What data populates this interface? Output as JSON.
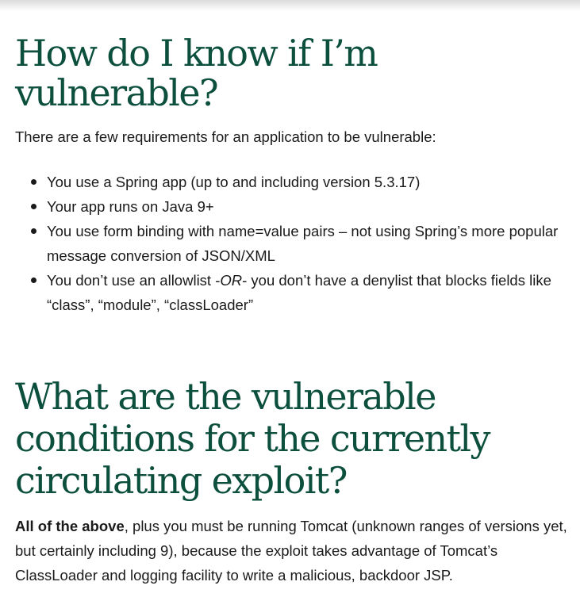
{
  "section1": {
    "heading": "How do I know if I’m vulnerable?",
    "intro": "There are a few requirements for an application to be vulnerable:",
    "requirements": [
      "You use a Spring app (up to and including version 5.3.17)",
      "Your app runs on Java 9+",
      "You use form binding with name=value pairs  – not using Spring’s more popular message conversion of JSON/XML"
    ],
    "allowlist_item": {
      "before": "You don’t use an allowlist -",
      "emphasis": "OR",
      "after": "- you don’t have a denylist that blocks fields like “class”, “module”, “classLoader”"
    }
  },
  "section2": {
    "heading": "What are the vulnerable conditions for the currently circulating exploit?",
    "bold_lead": "All of the above",
    "body": ", plus you must be running Tomcat (unknown ranges of versions yet, but certainly including 9), because the exploit takes advantage of Tomcat’s ClassLoader and logging facility to write a malicious, backdoor JSP."
  }
}
